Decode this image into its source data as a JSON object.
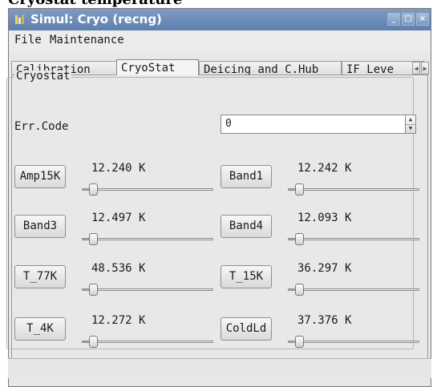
{
  "page": {
    "caption": "Cryostat temperature"
  },
  "window": {
    "title": "Simul: Cryo (recng)",
    "minimize_glyph": "_",
    "maximize_glyph": "□",
    "close_glyph": "×",
    "accent_color": "#5e7fae"
  },
  "menu": {
    "items": [
      {
        "label": "File"
      },
      {
        "label": "Maintenance"
      }
    ]
  },
  "tabs": {
    "items": [
      {
        "label": "Calibration"
      },
      {
        "label": "CryoStat",
        "active": true
      },
      {
        "label": "Deicing and C.Hub"
      },
      {
        "label": "IF Leve"
      }
    ],
    "scroll_left_glyph": "◀",
    "scroll_right_glyph": "▶"
  },
  "cryostat": {
    "group_title": "Cryostat",
    "err_code_label": "Err.Code",
    "err_code_value": "0",
    "controls": [
      {
        "button": "Amp15K",
        "reading": "12.240 K",
        "slider_fraction": 0.05
      },
      {
        "button": "Band1",
        "reading": "12.242 K",
        "slider_fraction": 0.05
      },
      {
        "button": "Band3",
        "reading": "12.497 K",
        "slider_fraction": 0.05
      },
      {
        "button": "Band4",
        "reading": "12.093 K",
        "slider_fraction": 0.05
      },
      {
        "button": "T_77K",
        "reading": "48.536 K",
        "slider_fraction": 0.05
      },
      {
        "button": "T_15K",
        "reading": "36.297 K",
        "slider_fraction": 0.05
      },
      {
        "button": "T_4K",
        "reading": "12.272 K",
        "slider_fraction": 0.05
      },
      {
        "button": "ColdLd",
        "reading": "37.376 K",
        "slider_fraction": 0.05
      }
    ]
  }
}
